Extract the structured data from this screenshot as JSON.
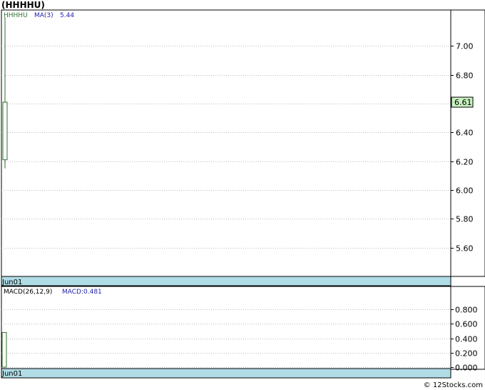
{
  "title": "(HHHHU)",
  "footer": "© 12Stocks.com",
  "colors": {
    "frame": "#000000",
    "grid": "#bbbbbb",
    "candle": "#2f6f2f",
    "ma_label": "#2222aa",
    "date_strip": "#b0dce6",
    "price_tag_bg": "#c8f0c0"
  },
  "chart_data": [
    {
      "type": "candlestick",
      "name": "price",
      "legend": {
        "symbol": "HHHHU",
        "ma_label": "MA(3)",
        "ma_value": "5.44"
      },
      "x_label": "Jun01",
      "last_price_tag": "6.61",
      "ylim": [
        5.4,
        7.25
      ],
      "yticks": [
        {
          "value": 7.0,
          "label": "7.00"
        },
        {
          "value": 6.8,
          "label": "6.80"
        },
        {
          "value": 6.6,
          "label": "6.60"
        },
        {
          "value": 6.4,
          "label": "6.40"
        },
        {
          "value": 6.2,
          "label": "6.20"
        },
        {
          "value": 6.0,
          "label": "6.00"
        },
        {
          "value": 5.8,
          "label": "5.80"
        },
        {
          "value": 5.6,
          "label": "5.60"
        }
      ],
      "candles": [
        {
          "date": "Jun01",
          "open": 6.21,
          "high": 7.2,
          "low": 6.15,
          "close": 6.61
        }
      ]
    },
    {
      "type": "bar",
      "name": "macd",
      "legend": {
        "label": "MACD(26,12,9)",
        "value_label": "MACD:0.481"
      },
      "x_label": "Jun01",
      "ylim": [
        -0.02,
        1.12
      ],
      "yticks": [
        {
          "value": 0.8,
          "label": "0.800"
        },
        {
          "value": 0.6,
          "label": "0.600"
        },
        {
          "value": 0.4,
          "label": "0.400"
        },
        {
          "value": 0.2,
          "label": "0.200"
        },
        {
          "value": 0.0,
          "label": "0.000"
        }
      ],
      "values": [
        0.481
      ]
    }
  ]
}
